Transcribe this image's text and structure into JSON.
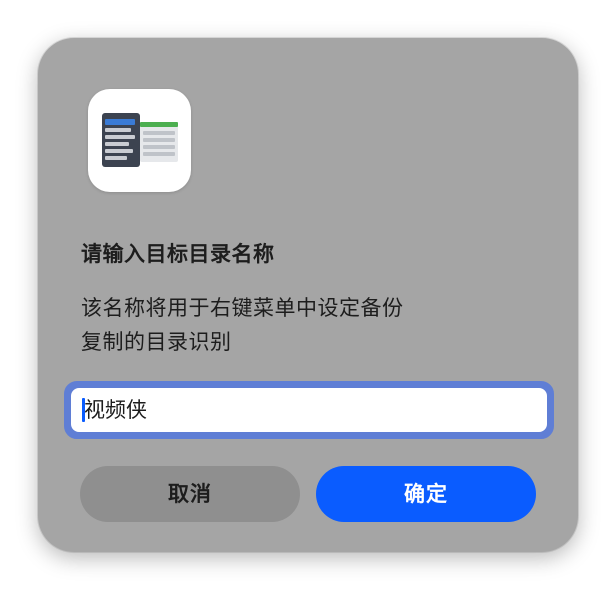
{
  "dialog": {
    "app_icon": "file-browser-app-icon",
    "title": "请输入目标目录名称",
    "message_lines": [
      "该名称将用于右键菜单中设定备份",
      "复制的目录识别"
    ],
    "input": {
      "value": "视频侠"
    },
    "cancel_label": "取消",
    "ok_label": "确定"
  },
  "colors": {
    "dialog_background": "#a5a5a5",
    "accent": "#0a5cff",
    "focus_ring": "#5f7ed5",
    "cancel_button": "#8f8f8f"
  }
}
